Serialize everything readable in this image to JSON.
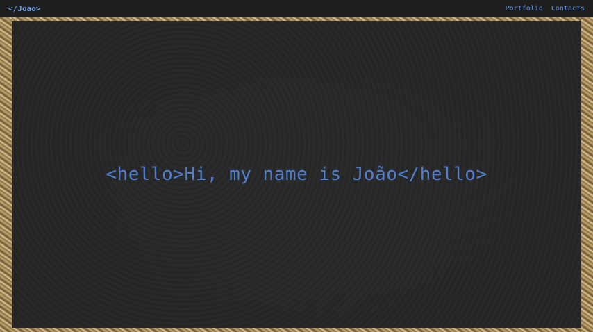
{
  "navbar": {
    "brand": "</João>",
    "links": [
      {
        "label": "Portfolio"
      },
      {
        "label": "Contacts"
      }
    ]
  },
  "hero": {
    "title": "<hello>Hi, my name is João</hello>"
  },
  "colors": {
    "accent": "#4f7fce",
    "nav_bg": "#1e1e1e",
    "overlay_bg": "#262626"
  }
}
